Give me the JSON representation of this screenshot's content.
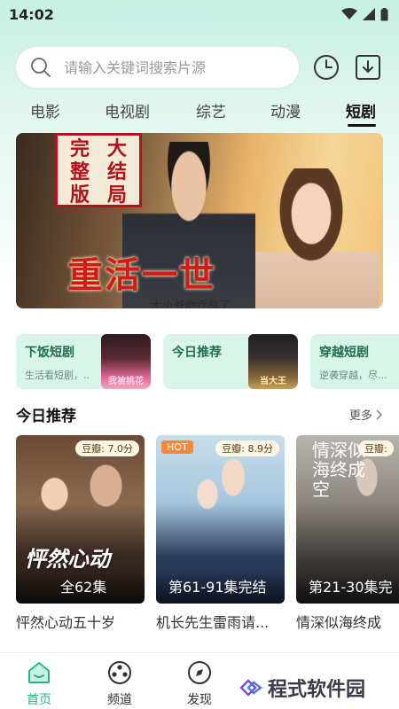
{
  "status_bar": {
    "time": "14:02"
  },
  "search": {
    "placeholder": "请输入关键词搜索片源"
  },
  "tabs": [
    {
      "label": "电影"
    },
    {
      "label": "电视剧"
    },
    {
      "label": "综艺"
    },
    {
      "label": "动漫"
    },
    {
      "label": "短剧",
      "active": true
    }
  ],
  "banner": {
    "seal_col1": [
      "完",
      "整",
      "版"
    ],
    "seal_col2": [
      "大",
      "结",
      "局"
    ],
    "title": "重活一世",
    "subtitle": "大小爷他乔疯了"
  },
  "categories": [
    {
      "title": "下饭短剧",
      "desc": "生活看短剧，..",
      "thumb_text": "我被桃花"
    },
    {
      "title": "今日推荐",
      "desc": "",
      "thumb_text": "当大王"
    },
    {
      "title": "穿越短剧",
      "desc": "逆袭穿越，尽..."
    }
  ],
  "section": {
    "title": "今日推荐",
    "more": "更多"
  },
  "posters": [
    {
      "score": "豆瓣: 7.0分",
      "episode": "全62集",
      "name": "怦然心动五十岁",
      "overlay": "怦然心动"
    },
    {
      "score": "豆瓣: 8.9分",
      "hot": "HOT",
      "episode": "第61-91集完结",
      "name": "机长先生雷雨请..."
    },
    {
      "score": "豆瓣:",
      "episode": "第21-30集完",
      "name": "情深似海终成",
      "side_title": "情深似海终成空"
    }
  ],
  "bottom_nav": [
    {
      "label": "首页",
      "active": true
    },
    {
      "label": "频道"
    },
    {
      "label": "发现"
    }
  ],
  "watermark": "程式软件园",
  "colors": {
    "accent": "#23b985",
    "tab_bg": "#d9f5ea"
  }
}
